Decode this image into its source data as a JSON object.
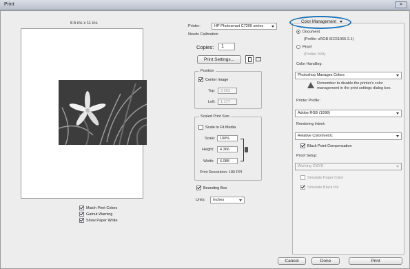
{
  "window": {
    "title": "Print"
  },
  "preview": {
    "paper_size": "8.5 ins x 11 ins"
  },
  "preview_options": [
    {
      "label": "Match Print Colors",
      "checked": true
    },
    {
      "label": "Gamut Warning",
      "checked": true
    },
    {
      "label": "Show Paper White",
      "checked": true
    }
  ],
  "printer": {
    "label": "Printer:",
    "value": "HP Photosmart C7200 series",
    "status": "Needs Calibration",
    "copies_label": "Copies:",
    "copies_value": "1",
    "settings_button": "Print Settings..."
  },
  "position": {
    "title": "Position",
    "center_label": "Center Image",
    "center_checked": true,
    "top_label": "Top:",
    "top_value": "3.263",
    "left_label": "Left:",
    "left_value": "1.177"
  },
  "scaled": {
    "title": "Scaled Print Size",
    "fit_label": "Scale to Fit Media",
    "fit_checked": false,
    "scale_label": "Scale:",
    "scale_value": "100%",
    "height_label": "Height:",
    "height_value": "4.366",
    "width_label": "Width:",
    "width_value": "6.088",
    "resolution": "Print Resolution: 180 PPI"
  },
  "bounding": {
    "label": "Bounding Box",
    "checked": true
  },
  "units": {
    "label": "Units:",
    "value": "Inches"
  },
  "color_mgmt": {
    "header": "Color Management",
    "document_label": "Document",
    "document_profile": "(Profile: sRGB IEC61966-2.1)",
    "proof_label": "Proof",
    "proof_profile": "(Profile: N/A)",
    "handling_label": "Color Handling:",
    "handling_value": "Photoshop Manages Colors",
    "warning": "Remember to disable the printer's color management in the print settings dialog box.",
    "profile_label": "Printer Profile:",
    "profile_value": "Adobe RGB (1998)",
    "intent_label": "Rendering Intent:",
    "intent_value": "Relative Colorimetric",
    "bpc_label": "Black Point Compensation",
    "proof_setup_label": "Proof Setup:",
    "proof_setup_value": "Working CMYK",
    "sim_paper_label": "Simulate Paper Color",
    "sim_black_label": "Simulate Black Ink"
  },
  "buttons": {
    "cancel": "Cancel",
    "done": "Done",
    "print": "Print"
  },
  "colors": {
    "highlight_oval": "#1e73b8",
    "accent": "#2a4a8a"
  }
}
